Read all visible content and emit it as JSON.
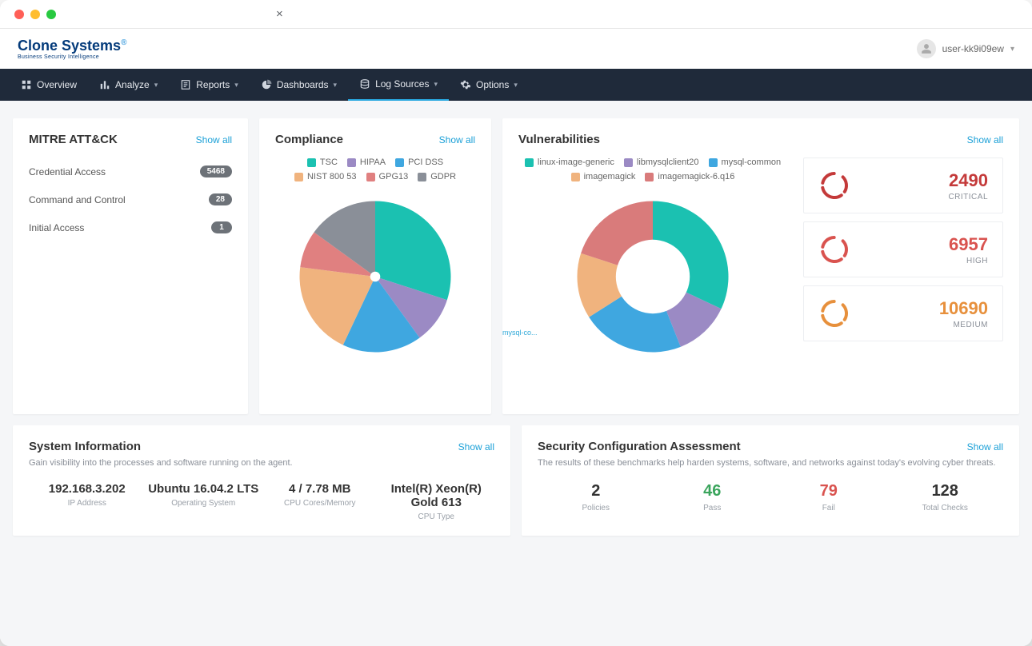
{
  "user": {
    "name": "user-kk9i09ew"
  },
  "logo": {
    "main": "Clone Systems",
    "sub": "Business Security Intelligence"
  },
  "nav": {
    "items": [
      {
        "label": "Overview",
        "icon": "grid",
        "chev": false
      },
      {
        "label": "Analyze",
        "icon": "analyze",
        "chev": true
      },
      {
        "label": "Reports",
        "icon": "reports",
        "chev": true
      },
      {
        "label": "Dashboards",
        "icon": "dashboards",
        "chev": true
      },
      {
        "label": "Log Sources",
        "icon": "logsources",
        "chev": true,
        "active": true
      },
      {
        "label": "Options",
        "icon": "options",
        "chev": true
      }
    ]
  },
  "show_all": "Show all",
  "mitre": {
    "title": "MITRE ATT&CK",
    "items": [
      {
        "label": "Credential Access",
        "count": "5468"
      },
      {
        "label": "Command and Control",
        "count": "28"
      },
      {
        "label": "Initial Access",
        "count": "1"
      }
    ]
  },
  "compliance": {
    "title": "Compliance",
    "legend": [
      {
        "label": "TSC",
        "color": "#1bc1b1"
      },
      {
        "label": "HIPAA",
        "color": "#9b8ac4"
      },
      {
        "label": "PCI DSS",
        "color": "#3fa7e0"
      },
      {
        "label": "NIST 800 53",
        "color": "#f0b37e"
      },
      {
        "label": "GPG13",
        "color": "#e08080"
      },
      {
        "label": "GDPR",
        "color": "#8a8f98"
      }
    ]
  },
  "vuln": {
    "title": "Vulnerabilities",
    "legend": [
      {
        "label": "linux-image-generic",
        "color": "#1bc1b1"
      },
      {
        "label": "libmysqlclient20",
        "color": "#9b8ac4"
      },
      {
        "label": "mysql-common",
        "color": "#3fa7e0"
      },
      {
        "label": "imagemagick",
        "color": "#f0b37e"
      },
      {
        "label": "imagemagick-6.q16",
        "color": "#d97b7b"
      }
    ],
    "donut_label": "mysql-co...",
    "stats": [
      {
        "value": "2490",
        "label": "CRITICAL",
        "color": "#c43a3a",
        "class": "stat-critical"
      },
      {
        "value": "6957",
        "label": "HIGH",
        "color": "#d9534f",
        "class": "stat-high"
      },
      {
        "value": "10690",
        "label": "MEDIUM",
        "color": "#e7903c",
        "class": "stat-medium"
      }
    ]
  },
  "sysinfo": {
    "title": "System Information",
    "sub": "Gain visibility into the processes and software running on the agent.",
    "items": [
      {
        "value": "192.168.3.202",
        "label": "IP Address"
      },
      {
        "value": "Ubuntu 16.04.2 LTS",
        "label": "Operating System"
      },
      {
        "value": "4 / 7.78 MB",
        "label": "CPU Cores/Memory"
      },
      {
        "value": "Intel(R) Xeon(R) Gold 613",
        "label": "CPU Type"
      }
    ]
  },
  "sca": {
    "title": "Security Configuration Assessment",
    "sub": "The results of these benchmarks help harden systems, software, and networks against today's evolving cyber threats.",
    "items": [
      {
        "value": "2",
        "label": "Policies",
        "class": ""
      },
      {
        "value": "46",
        "label": "Pass",
        "class": "sca-pass"
      },
      {
        "value": "79",
        "label": "Fail",
        "class": "sca-fail"
      },
      {
        "value": "128",
        "label": "Total Checks",
        "class": ""
      }
    ]
  },
  "chart_data": [
    {
      "type": "pie",
      "title": "Compliance",
      "series": [
        {
          "name": "TSC",
          "value": 30,
          "color": "#1bc1b1"
        },
        {
          "name": "HIPAA",
          "value": 10,
          "color": "#9b8ac4"
        },
        {
          "name": "PCI DSS",
          "value": 17,
          "color": "#3fa7e0"
        },
        {
          "name": "NIST 800 53",
          "value": 20,
          "color": "#f0b37e"
        },
        {
          "name": "GPG13",
          "value": 8,
          "color": "#e08080"
        },
        {
          "name": "GDPR",
          "value": 15,
          "color": "#8a8f98"
        }
      ]
    },
    {
      "type": "pie",
      "title": "Vulnerabilities",
      "donut": true,
      "series": [
        {
          "name": "linux-image-generic",
          "value": 32,
          "color": "#1bc1b1"
        },
        {
          "name": "libmysqlclient20",
          "value": 12,
          "color": "#9b8ac4"
        },
        {
          "name": "mysql-common",
          "value": 22,
          "color": "#3fa7e0"
        },
        {
          "name": "imagemagick",
          "value": 14,
          "color": "#f0b37e"
        },
        {
          "name": "imagemagick-6.q16",
          "value": 20,
          "color": "#d97b7b"
        }
      ]
    }
  ]
}
